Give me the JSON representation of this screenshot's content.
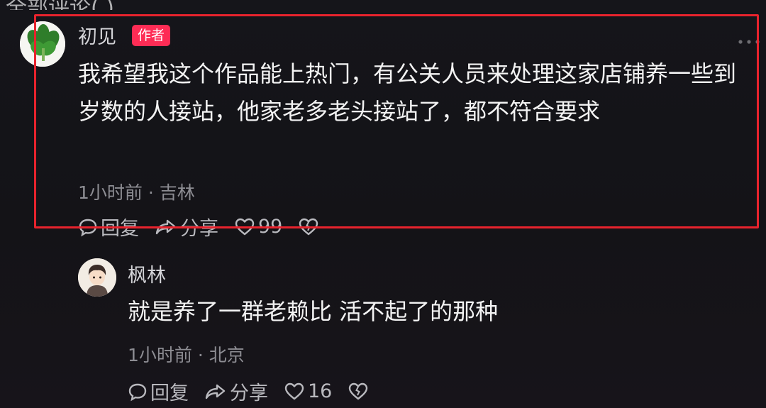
{
  "top_header": {
    "text": "全部评论( )"
  },
  "main_comment": {
    "username": "初见",
    "badge": "作者",
    "text": "我希望我这个作品能上热门，有公关人员来处理这家店铺养一些到岁数的人接站，他家老多老头接站了，都不符合要求",
    "meta": "1小时前 · 吉林",
    "reply_label": "回复",
    "share_label": "分享",
    "like_count": "99",
    "highlight_color": "#e8232d"
  },
  "reply_comment": {
    "username": "枫林",
    "text": "就是养了一群老赖比 活不起了的那种",
    "meta": "1小时前 · 北京",
    "reply_label": "回复",
    "share_label": "分享",
    "like_count": "16"
  },
  "colors": {
    "background": "#141317",
    "author_badge": "#fe2c55",
    "meta_text": "#8d8d93"
  }
}
